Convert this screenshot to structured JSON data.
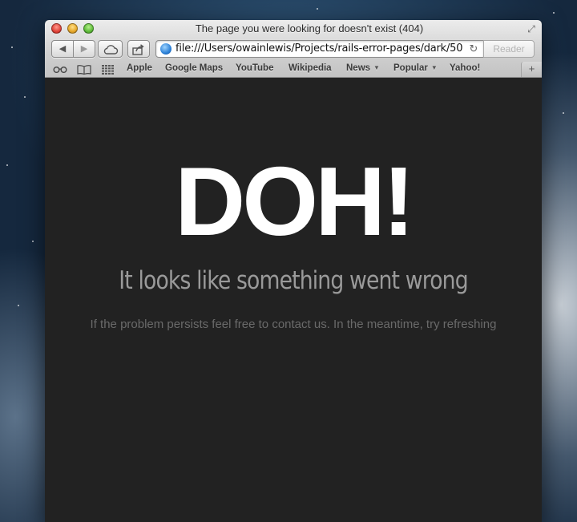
{
  "window": {
    "title": "The page you were looking for doesn't exist (404)"
  },
  "toolbar": {
    "back_icon": "◀",
    "forward_icon": "▶",
    "icloud_icon": "cloud-icon",
    "share_icon": "share-icon",
    "url": "file:///Users/owainlewis/Projects/rails-error-pages/dark/50",
    "reload_icon": "↻",
    "reader_label": "Reader"
  },
  "bookmarks": {
    "items": [
      {
        "label": "Apple"
      },
      {
        "label": "Google Maps"
      },
      {
        "label": "YouTube"
      },
      {
        "label": "Wikipedia"
      },
      {
        "label": "News",
        "dropdown": true
      },
      {
        "label": "Popular",
        "dropdown": true
      },
      {
        "label": "Yahoo!"
      }
    ],
    "new_tab_icon": "+"
  },
  "page": {
    "headline": "DOH!",
    "subheading": "It looks like something went wrong",
    "body": "If the problem persists feel free to contact us. In the meantime, try refreshing",
    "colors": {
      "background": "#222222",
      "headline": "#ffffff",
      "subheading": "#9a9a9a",
      "body": "#6a6a6a"
    }
  }
}
